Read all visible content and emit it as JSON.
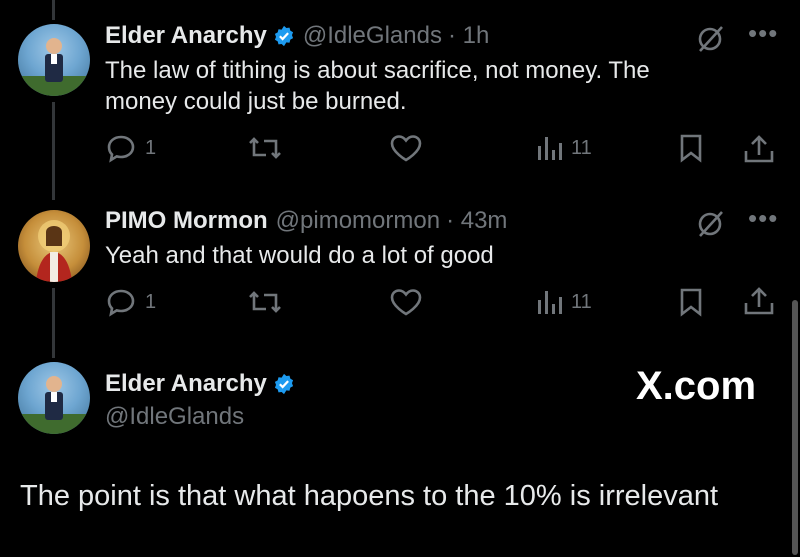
{
  "tweets": [
    {
      "name": "Elder Anarchy",
      "handle": "@IdleGlands",
      "time": "· 1h",
      "text_line1": "The law of tithing is about sacrifice, not money. The",
      "text_line2": "money could just be burned.",
      "replies": "1",
      "views": "11"
    },
    {
      "name": "PIMO Mormon",
      "handle": "@pimomormon",
      "time": "· 43m",
      "text_line1": "Yeah and that would do a lot of good",
      "replies": "1",
      "views": "11"
    }
  ],
  "main_tweet": {
    "name": "Elder Anarchy",
    "handle": "@IdleGlands",
    "text": "The point is that what hapoens to the 10% is irrelevant"
  },
  "watermark": "X.com",
  "colors": {
    "accent": "#1d9bf0",
    "muted": "#71767b",
    "text": "#e7e9ea",
    "background": "#000000"
  }
}
